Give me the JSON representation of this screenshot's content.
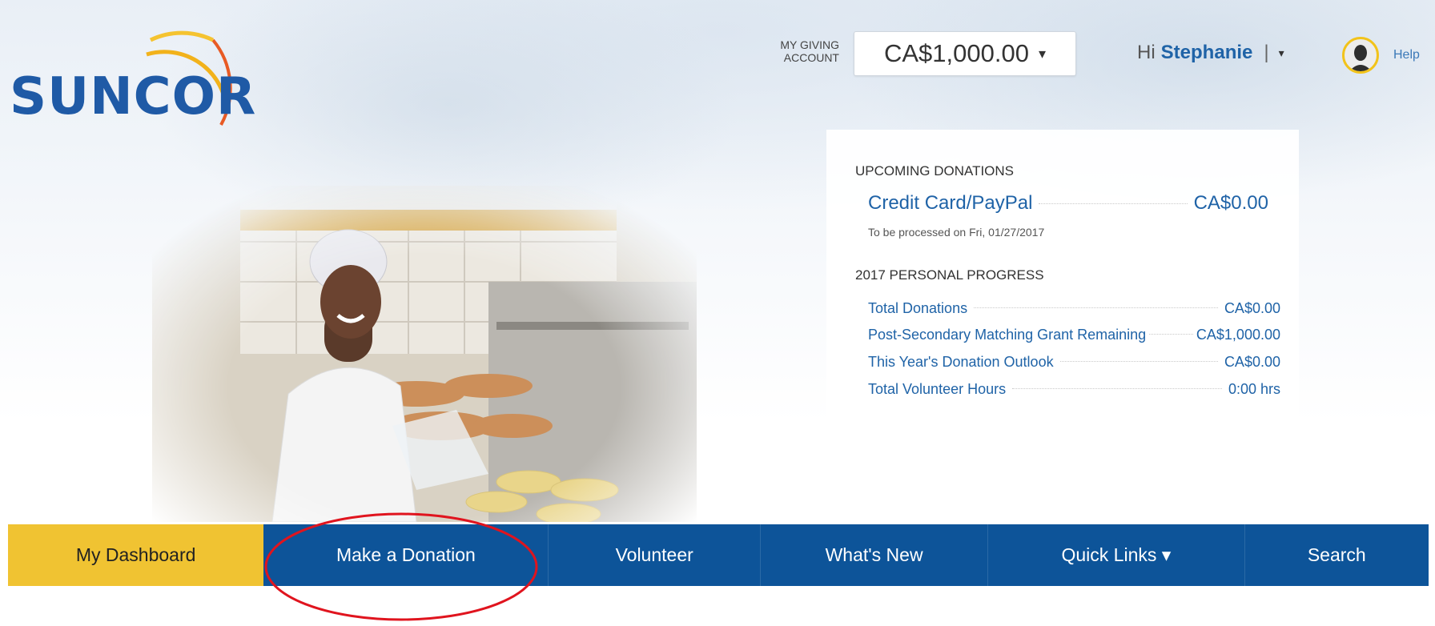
{
  "brand": {
    "logo_text": "SUNCOR"
  },
  "account": {
    "label": "MY GIVING ACCOUNT",
    "balance": "CA$1,000.00",
    "caret": "▾"
  },
  "user": {
    "greeting": "Hi",
    "name": "Stephanie",
    "separator": "|",
    "menu_caret": "▾",
    "help": "Help"
  },
  "summary": {
    "upcoming_title": "UPCOMING DONATIONS",
    "upcoming": {
      "method": "Credit Card/PayPal",
      "amount": "CA$0.00",
      "note": "To be processed on Fri, 01/27/2017"
    },
    "progress_title": "2017 PERSONAL PROGRESS",
    "progress": [
      {
        "label": "Total Donations",
        "value": "CA$0.00"
      },
      {
        "label": "Post-Secondary Matching Grant Remaining",
        "value": "CA$1,000.00"
      },
      {
        "label": "This Year's Donation Outlook",
        "value": "CA$0.00"
      },
      {
        "label": "Total Volunteer Hours",
        "value": "0:00 hrs"
      }
    ]
  },
  "nav": {
    "items": [
      {
        "label": "My Dashboard"
      },
      {
        "label": "Make a Donation"
      },
      {
        "label": "Volunteer"
      },
      {
        "label": "What's New"
      },
      {
        "label": "Quick Links ▾"
      },
      {
        "label": "Search"
      }
    ]
  },
  "colors": {
    "brand_blue": "#1f5aa6",
    "nav_blue": "#0d5499",
    "active_tab": "#f0c332",
    "link_blue": "#1f63a7",
    "annotation_red": "#e0141e"
  }
}
